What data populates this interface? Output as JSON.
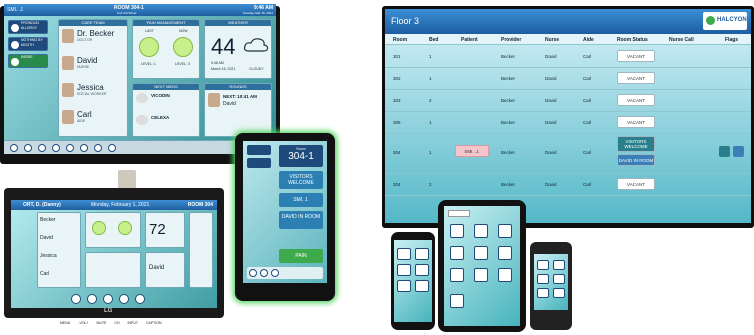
{
  "tv1": {
    "patient": "SMI.. J.",
    "room": "ROOM 304-1",
    "unit": "Unit 3rd Street",
    "time": "9:46 AM",
    "date": "Tuesday, Mar 16, 2021",
    "sidebar": [
      "PRONOUN ALLERGY",
      "NOTHING BY MOUTH",
      "INSIDE"
    ],
    "care_team_title": "CARE TEAM",
    "care_team": [
      {
        "name": "Dr. Becker",
        "role": "DOCTOR"
      },
      {
        "name": "David",
        "role": "NURSE"
      },
      {
        "name": "Jessica",
        "role": "SOCIAL WORKER"
      },
      {
        "name": "Carl",
        "role": "AIDE"
      }
    ],
    "pain_title": "PAIN MANAGEMENT",
    "pain": {
      "last": "LAST",
      "now": "NOW",
      "level_last": "LEVEL: 1",
      "level_now": "LEVEL: 3"
    },
    "weather_title": "WEATHER",
    "weather": {
      "temp": "44",
      "time": "9:46 AM",
      "date": "March 16, 2021",
      "cond": "CLOUDY"
    },
    "meds_title": "NEXT MEDS",
    "meds": [
      {
        "name": "VICODIN"
      },
      {
        "name": "CELEXA"
      }
    ],
    "rounds_title": "ROUNDS",
    "rounds": {
      "next": "NEXT: 10:41 AM",
      "who": "David"
    }
  },
  "lg": {
    "patient": "ORT, D. (Danny)",
    "date": "Monday, February 1, 2021",
    "room": "ROOM 304",
    "people": [
      "Becker",
      "David",
      "Jessica",
      "Carl"
    ],
    "temp": "72",
    "rounds_name": "David",
    "brand": "LG",
    "remote_labels": [
      "MENU",
      "-VOL+",
      "MUTE",
      "CH",
      "INPUT",
      "CAPTION"
    ]
  },
  "tablet": {
    "room_label": "Room",
    "room": "304-1",
    "visitors": "VISITORS WELCOME",
    "patient": "SMI, J.",
    "nurse": "DAVID IN ROOM",
    "pain": "PAIN"
  },
  "monitor": {
    "floor": "Floor 3",
    "logo": "HALCYON",
    "headers": [
      "Room",
      "Bed",
      "Patient",
      "Provider",
      "Nurse",
      "Aide",
      "Room Status",
      "Nurse Call",
      "Flags"
    ],
    "rows": [
      {
        "room": "301",
        "bed": "1",
        "patient": "",
        "provider": "Becker",
        "nurse": "David",
        "aide": "Carl",
        "status": [
          "VACANT"
        ]
      },
      {
        "room": "302",
        "bed": "1",
        "patient": "",
        "provider": "Becker",
        "nurse": "David",
        "aide": "Carl",
        "status": [
          "VACANT"
        ]
      },
      {
        "room": "303",
        "bed": "2",
        "patient": "",
        "provider": "Becker",
        "nurse": "David",
        "aide": "Carl",
        "status": [
          "VACANT"
        ]
      },
      {
        "room": "305",
        "bed": "1",
        "patient": "",
        "provider": "Becker",
        "nurse": "David",
        "aide": "Carl",
        "status": [
          "VACANT"
        ]
      },
      {
        "room": "304",
        "bed": "1",
        "patient": "SMI.. J.",
        "provider": "Becker",
        "nurse": "David",
        "aide": "Carl",
        "status": [
          "VISITORS WELCOME",
          "DAVID IN ROOM"
        ]
      },
      {
        "room": "304",
        "bed": "2",
        "patient": "",
        "provider": "Becker",
        "nurse": "David",
        "aide": "Carl",
        "status": [
          "VACANT"
        ]
      }
    ]
  },
  "colors": {
    "accent": "#2f6f9c",
    "glow": "#4cd35a",
    "pink": "#f4c6cc"
  }
}
